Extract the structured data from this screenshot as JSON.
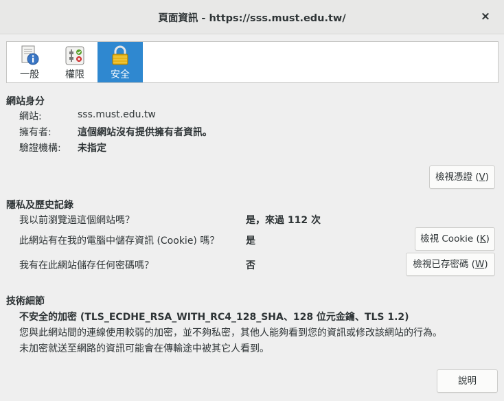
{
  "window": {
    "title": "頁面資訊 - https://sss.must.edu.tw/",
    "close_glyph": "×"
  },
  "tabs": [
    {
      "label": "一般",
      "icon": "document-info-icon",
      "active": false
    },
    {
      "label": "權限",
      "icon": "permissions-toggle-icon",
      "active": false
    },
    {
      "label": "安全",
      "icon": "padlock-icon",
      "active": true
    }
  ],
  "identity": {
    "heading": "網站身分",
    "website_label": "網站:",
    "website_value": "sss.must.edu.tw",
    "owner_label": "擁有者:",
    "owner_value": "這個網站沒有提供擁有者資訊。",
    "verifier_label": "驗證機構:",
    "verifier_value": "未指定",
    "view_cert_text": "檢視憑證 (",
    "view_cert_key": "V",
    "view_cert_end": ")"
  },
  "privacy": {
    "heading": "隱私及歷史記錄",
    "q1": "我以前瀏覽過這個網站嗎？",
    "a1": "是，來過 112 次",
    "q2": "此網站有在我的電腦中儲存資訊 (Cookie) 嗎？",
    "a2": "是",
    "cookie_btn_text": "檢視 Cookie (",
    "cookie_btn_key": "K",
    "cookie_btn_end": ")",
    "q3": "我有在此網站儲存任何密碼嗎？",
    "a3": "否",
    "pw_btn_text": "檢視已存密碼 (",
    "pw_btn_key": "W",
    "pw_btn_end": ")"
  },
  "tech": {
    "heading": "技術細節",
    "line1": "不安全的加密 (TLS_ECDHE_RSA_WITH_RC4_128_SHA、128 位元金鑰、TLS 1.2)",
    "line2": "您與此網站間的連線使用較弱的加密，並不夠私密，其他人能夠看到您的資訊或修改該網站的行為。",
    "line3": "未加密就送至網路的資訊可能會在傳輸途中被其它人看到。"
  },
  "help_button": "說明"
}
